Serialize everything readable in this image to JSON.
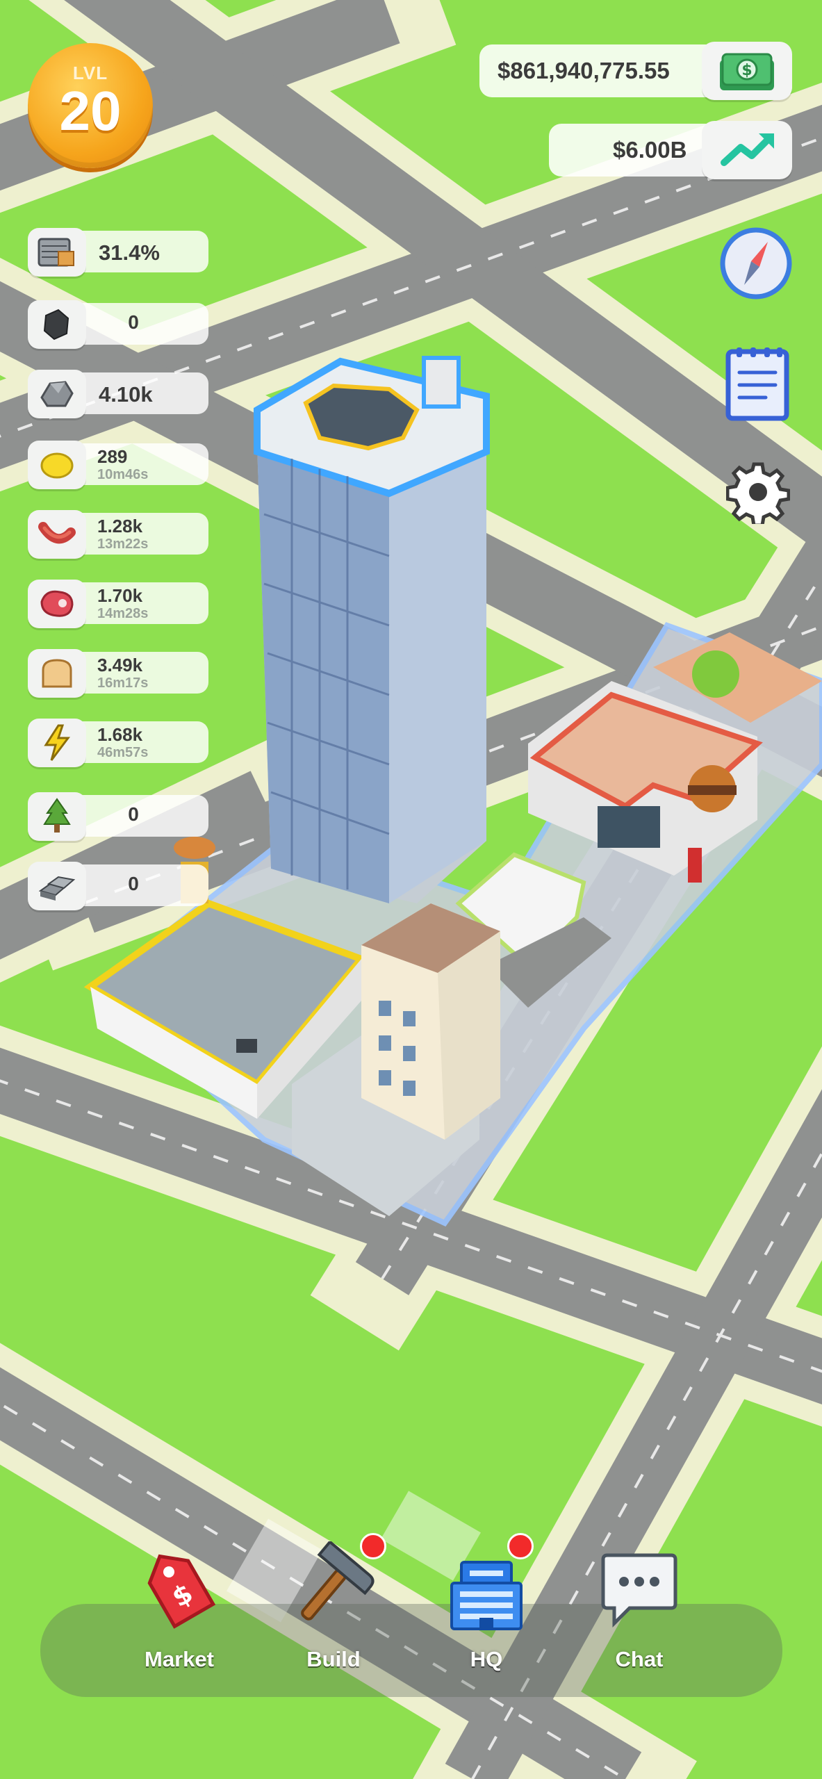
{
  "level": {
    "label": "LVL",
    "value": "20"
  },
  "money": {
    "balance": "$861,940,775.55",
    "income": "$6.00B",
    "icon": "cash-stack-icon",
    "income_icon": "trend-up-icon"
  },
  "resources": [
    {
      "id": "storage",
      "icon": "warehouse-crate-icon",
      "value": "31.4%"
    },
    {
      "id": "coal",
      "icon": "coal-lump-icon",
      "value": "0"
    },
    {
      "id": "ore",
      "icon": "ore-rock-icon",
      "value": "4.10k"
    },
    {
      "id": "lemon",
      "icon": "lemon-icon",
      "value": "289",
      "timer": "10m46s"
    },
    {
      "id": "sausage",
      "icon": "sausage-icon",
      "value": "1.28k",
      "timer": "13m22s"
    },
    {
      "id": "meat",
      "icon": "steak-icon",
      "value": "1.70k",
      "timer": "14m28s"
    },
    {
      "id": "bread",
      "icon": "bread-slice-icon",
      "value": "3.49k",
      "timer": "16m17s"
    },
    {
      "id": "energy",
      "icon": "lightning-icon",
      "value": "1.68k",
      "timer": "46m57s"
    },
    {
      "id": "wood",
      "icon": "pine-tree-icon",
      "value": "0"
    },
    {
      "id": "metal",
      "icon": "metal-ingots-icon",
      "value": "0"
    }
  ],
  "side_buttons": [
    "compass-icon",
    "news-notepad-icon",
    "gear-icon"
  ],
  "nav": [
    {
      "label": "Market",
      "icon": "price-tag-icon",
      "badge": false
    },
    {
      "label": "Build",
      "icon": "hammer-icon",
      "badge": true
    },
    {
      "label": "HQ",
      "icon": "office-building-icon",
      "badge": true
    },
    {
      "label": "Chat",
      "icon": "chat-bubble-icon",
      "badge": false
    }
  ],
  "colors": {
    "grass": "#8ee04f",
    "road": "#8f9190",
    "sidewalk": "#f1f2d4",
    "accent_orange": "#f6a51c",
    "badge_red": "#f22a2a"
  }
}
